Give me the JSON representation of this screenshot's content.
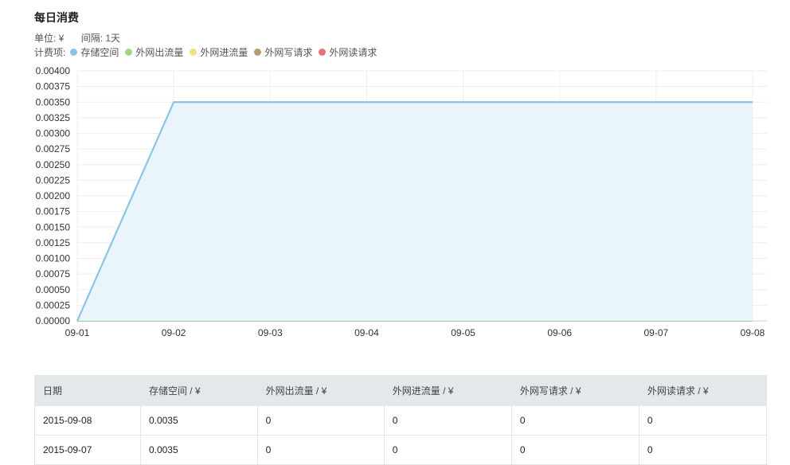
{
  "title": "每日消费",
  "unit": "单位: ¥",
  "interval": "间隔: 1天",
  "legend_label": "计费项:",
  "legend": [
    {
      "name": "存储空间",
      "color": "#89c5e3"
    },
    {
      "name": "外网出流量",
      "color": "#9fd58a"
    },
    {
      "name": "外网进流量",
      "color": "#f2e07c"
    },
    {
      "name": "外网写请求",
      "color": "#b89a74"
    },
    {
      "name": "外网读请求",
      "color": "#e57373"
    }
  ],
  "chart_data": {
    "type": "area",
    "x": [
      "09-01",
      "09-02",
      "09-03",
      "09-04",
      "09-05",
      "09-06",
      "09-07",
      "09-08"
    ],
    "ylim": [
      0,
      0.004
    ],
    "yticks": [
      "0.00000",
      "0.00025",
      "0.00050",
      "0.00075",
      "0.00100",
      "0.00125",
      "0.00150",
      "0.00175",
      "0.00200",
      "0.00225",
      "0.00250",
      "0.00275",
      "0.00300",
      "0.00325",
      "0.00350",
      "0.00375",
      "0.00400"
    ],
    "grid": true,
    "series": [
      {
        "name": "存储空间",
        "values": [
          0,
          0.0035,
          0.0035,
          0.0035,
          0.0035,
          0.0035,
          0.0035,
          0.0035
        ],
        "color": "#89c5e3",
        "fill": "#e8f3fb"
      },
      {
        "name": "外网出流量",
        "values": [
          0,
          0,
          0,
          0,
          0,
          0,
          0,
          0
        ],
        "color": "#9fd58a"
      },
      {
        "name": "外网进流量",
        "values": [
          0,
          0,
          0,
          0,
          0,
          0,
          0,
          0
        ],
        "color": "#f2e07c"
      },
      {
        "name": "外网写请求",
        "values": [
          0,
          0,
          0,
          0,
          0,
          0,
          0,
          0
        ],
        "color": "#b89a74"
      },
      {
        "name": "外网读请求",
        "values": [
          0,
          0,
          0,
          0,
          0,
          0,
          0,
          0
        ],
        "color": "#e57373"
      }
    ]
  },
  "table": {
    "headers": [
      "日期",
      "存储空间 / ¥",
      "外网出流量 / ¥",
      "外网进流量 / ¥",
      "外网写请求 / ¥",
      "外网读请求 / ¥"
    ],
    "rows": [
      [
        "2015-09-08",
        "0.0035",
        "0",
        "0",
        "0",
        "0"
      ],
      [
        "2015-09-07",
        "0.0035",
        "0",
        "0",
        "0",
        "0"
      ]
    ]
  }
}
